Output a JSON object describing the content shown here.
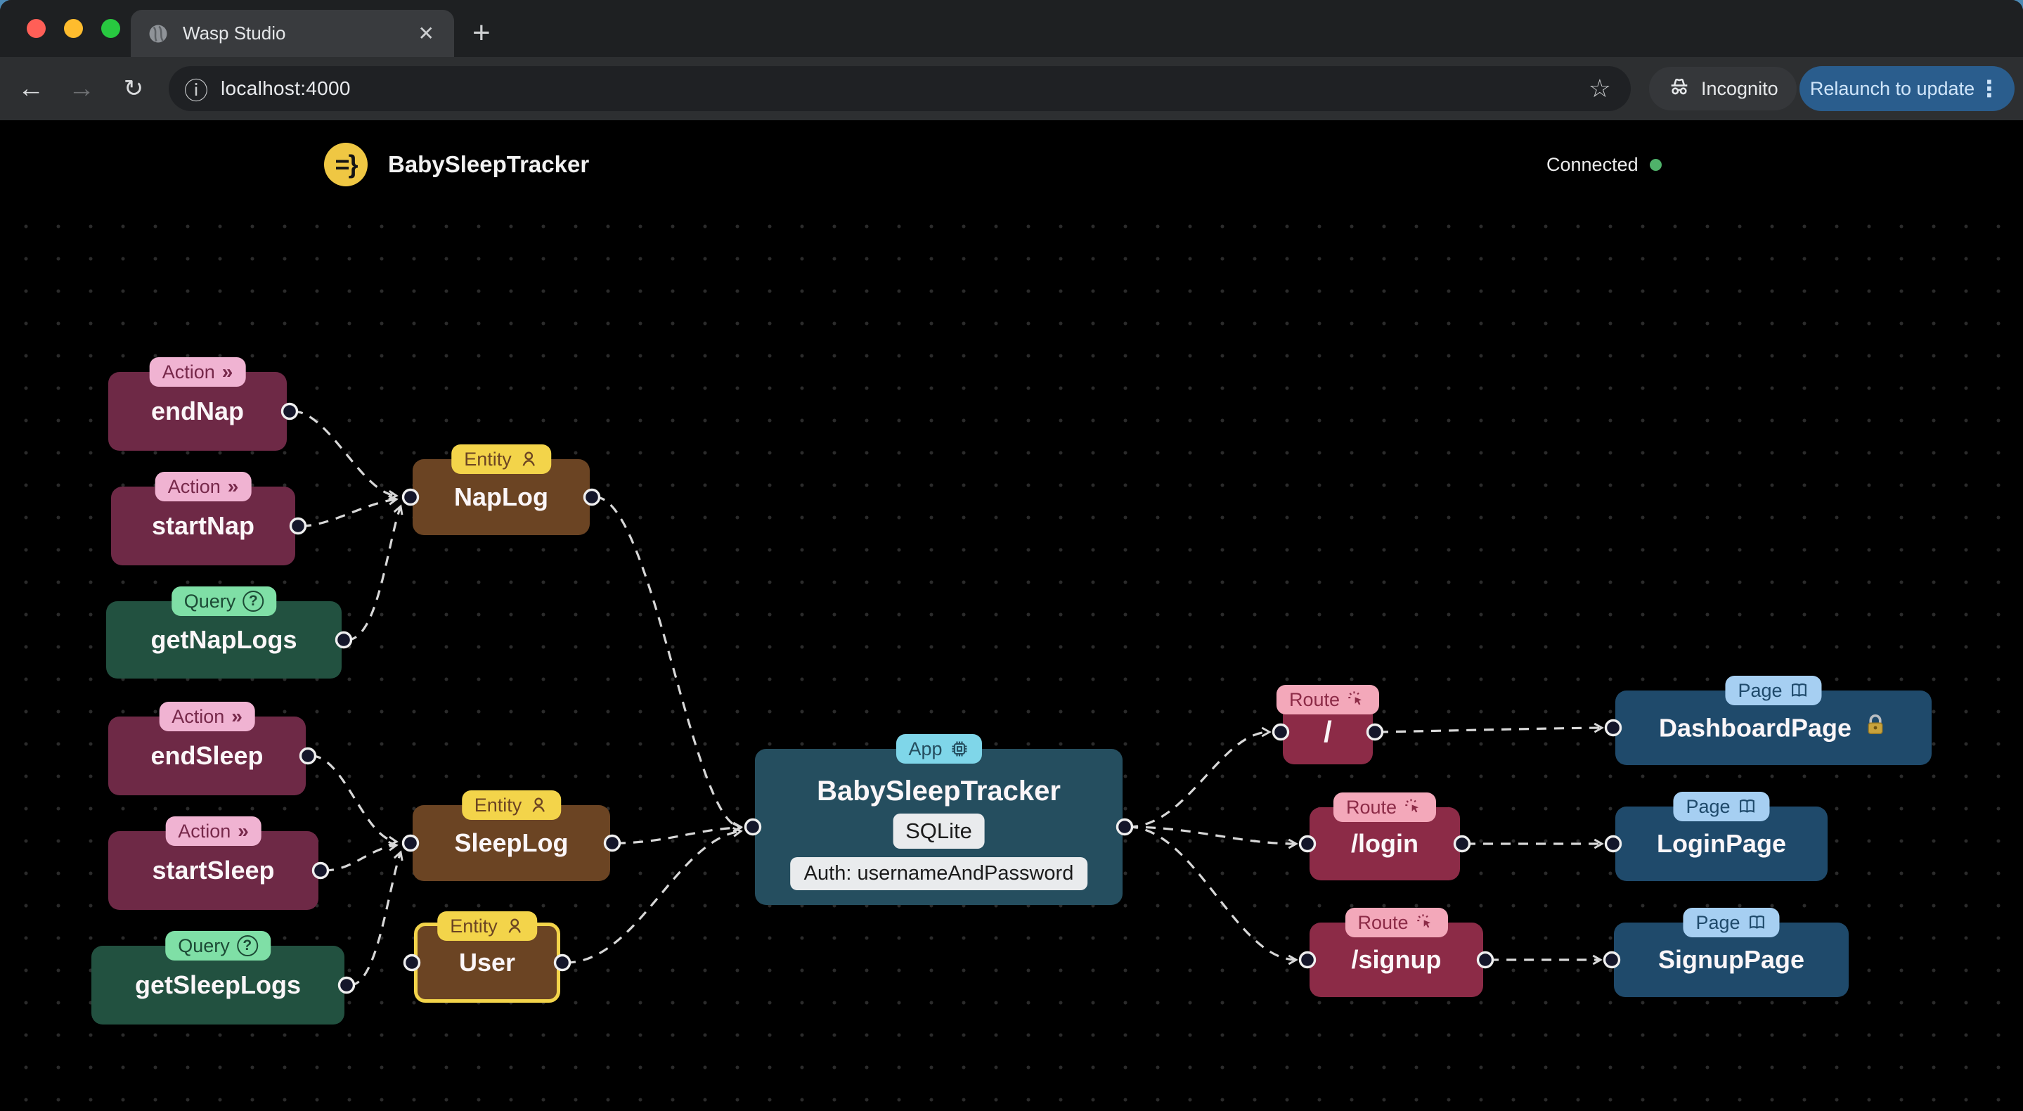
{
  "browser": {
    "tab_title": "Wasp Studio",
    "url": "localhost:4000",
    "incognito_label": "Incognito",
    "relaunch_label": "Relaunch to update",
    "glyphs": {
      "close": "✕",
      "new_tab": "+",
      "back": "←",
      "forward": "→",
      "reload": "↻",
      "info": "ⓘ",
      "star": "☆",
      "kebab": "⋮"
    }
  },
  "header": {
    "logo_glyph": "=}",
    "title": "BabySleepTracker",
    "status": "Connected"
  },
  "icons": {
    "action_glyph": "»",
    "query": "question-circle-icon",
    "entity": "person-icon",
    "app": "chip-icon",
    "route": "cursor-click-icon",
    "page": "open-book-icon",
    "dashboard_lock": "lock-icon"
  },
  "nodes": {
    "end_nap": {
      "badge": "Action",
      "label": "endNap"
    },
    "start_nap": {
      "badge": "Action",
      "label": "startNap"
    },
    "get_nap_logs": {
      "badge": "Query",
      "label": "getNapLogs"
    },
    "end_sleep": {
      "badge": "Action",
      "label": "endSleep"
    },
    "start_sleep": {
      "badge": "Action",
      "label": "startSleep"
    },
    "get_sleep_logs": {
      "badge": "Query",
      "label": "getSleepLogs"
    },
    "nap_log": {
      "badge": "Entity",
      "label": "NapLog"
    },
    "sleep_log": {
      "badge": "Entity",
      "label": "SleepLog"
    },
    "user": {
      "badge": "Entity",
      "label": "User"
    },
    "app": {
      "badge": "App",
      "label": "BabySleepTracker",
      "db": "SQLite",
      "auth": "Auth: usernameAndPassword"
    },
    "route_root": {
      "badge": "Route",
      "label": "/"
    },
    "route_login": {
      "badge": "Route",
      "label": "/login"
    },
    "route_signup": {
      "badge": "Route",
      "label": "/signup"
    },
    "page_dashboard": {
      "badge": "Page",
      "label": "DashboardPage"
    },
    "page_login": {
      "badge": "Page",
      "label": "LoginPage"
    },
    "page_signup": {
      "badge": "Page",
      "label": "SignupPage"
    }
  },
  "colors": {
    "action_node": "#6e2946",
    "query_node": "#225140",
    "entity_node": "#6b4423",
    "app_node": "#254e5f",
    "route_node": "#8c2b47",
    "page_node": "#1f4a6b",
    "edge": "#d8d8d8",
    "status_dot": "#4fb26a",
    "relaunch_button": "#2a5d8d",
    "wasp_yellow": "#efc743",
    "user_highlight": "#f3d44a"
  }
}
